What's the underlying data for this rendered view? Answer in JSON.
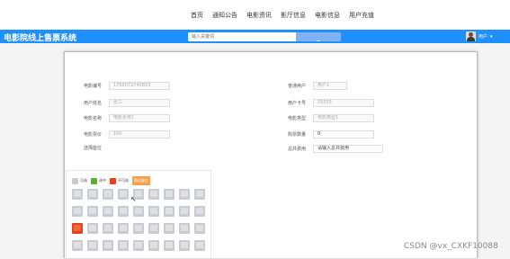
{
  "topnav": {
    "links": [
      "首页",
      "通知公告",
      "电影资讯",
      "影厅信息",
      "电影信息",
      "用户充值"
    ]
  },
  "header": {
    "brand": "电影院线上售票系统",
    "search_placeholder": "输入关键词",
    "user_name": "用户",
    "user_dropdown": "▾",
    "bar_color": "#1e90ff"
  },
  "form": {
    "left": [
      {
        "label": "电影编号",
        "value": "1765072740853"
      },
      {
        "label": "用户姓名",
        "value": "张三"
      },
      {
        "label": "电影名称",
        "value": "电影名称1"
      },
      {
        "label": "电影票价",
        "value": "100"
      },
      {
        "label": "选择座位",
        "value": ""
      }
    ],
    "right": [
      {
        "label": "普通用户",
        "value": "用户1"
      },
      {
        "label": "用户卡号",
        "value": "55555"
      },
      {
        "label": "电影类型",
        "value": "电影类型1"
      },
      {
        "label": "购票数量",
        "value": "0"
      },
      {
        "label": "总共费用",
        "value": "请输入总共费用"
      }
    ]
  },
  "seat_legend": {
    "available": "可选",
    "selected": "选中",
    "unavailable": "不可选",
    "tag": "购买座位"
  },
  "legend_colors": {
    "available": "#c8ccd2",
    "selected": "#5cb030",
    "unavailable": "#e8401c"
  },
  "seat_rows": [
    [
      "free",
      "free",
      "free",
      "free",
      "free",
      "free",
      "free",
      "free",
      "free"
    ],
    [
      "free",
      "free",
      "free",
      "free",
      "free",
      "free",
      "free",
      "free",
      "free"
    ],
    [
      "sold",
      "free",
      "free",
      "free",
      "free",
      "free",
      "free",
      "free",
      "free"
    ],
    [
      "free",
      "free",
      "free",
      "free",
      "free",
      "free",
      "free",
      "free",
      "free"
    ]
  ],
  "watermark": "CSDN @vx_CXKF10088"
}
